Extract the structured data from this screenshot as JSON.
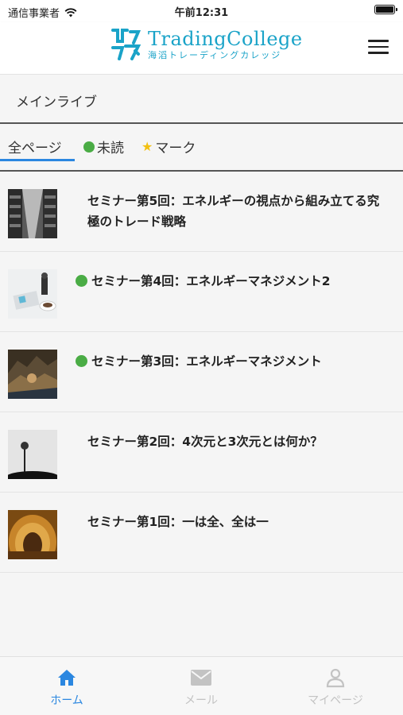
{
  "status_bar": {
    "carrier": "通信事業者",
    "time": "午前12:31"
  },
  "header": {
    "logo_title": "TradingCollege",
    "logo_subtitle": "海滔トレーディングカレッジ"
  },
  "section": {
    "title": "メインライブ"
  },
  "tabs": [
    {
      "label": "全ページ",
      "active": true
    },
    {
      "label": "未読"
    },
    {
      "label": "マーク"
    }
  ],
  "items": [
    {
      "title": "セミナー第5回：エネルギーの視点から組み立てる究極のトレード戦略",
      "unread": false,
      "thumb": "library-aisle-image"
    },
    {
      "title": "セミナー第4回：エネルギーマネジメント2",
      "unread": true,
      "thumb": "desk-workspace-image"
    },
    {
      "title": "セミナー第3回：エネルギーマネジメント",
      "unread": true,
      "thumb": "rocky-landscape-image"
    },
    {
      "title": "セミナー第2回：4次元と3次元とは何か？",
      "unread": false,
      "thumb": "lamp-post-image"
    },
    {
      "title": "セミナー第1回：一は全、全は一",
      "unread": false,
      "thumb": "tunnel-image"
    }
  ],
  "bottom_nav": {
    "home": "ホーム",
    "mail": "メール",
    "mypage": "マイページ"
  },
  "colors": {
    "accent": "#2b87e0",
    "brand": "#1aa3c8",
    "unread_dot": "#4aac45",
    "star": "#f2c011"
  }
}
